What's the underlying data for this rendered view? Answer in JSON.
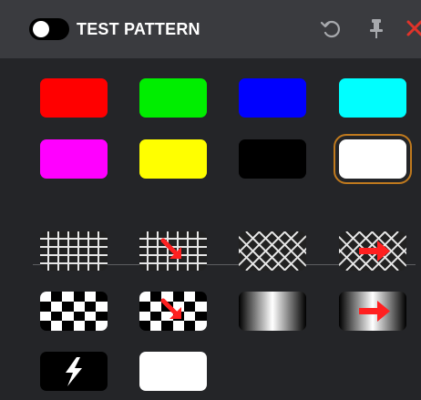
{
  "header": {
    "title": "TEST PATTERN",
    "toggle_state": "off",
    "icons": [
      "reset-icon",
      "pin-icon",
      "close-icon"
    ],
    "colors": {
      "header_bg": "#3a3b3f",
      "panel_bg": "#242528",
      "close": "#e0332a",
      "selection_ring": "#c07a1e"
    }
  },
  "color_swatches": [
    {
      "name": "red",
      "color": "#ff0000"
    },
    {
      "name": "green",
      "color": "#00ee00"
    },
    {
      "name": "blue",
      "color": "#0000ff"
    },
    {
      "name": "cyan",
      "color": "#00ffff"
    },
    {
      "name": "magenta",
      "color": "#ff00ff"
    },
    {
      "name": "yellow",
      "color": "#ffff00"
    },
    {
      "name": "black",
      "color": "#000000"
    },
    {
      "name": "white",
      "color": "#ffffff",
      "selected": true
    }
  ],
  "patterns": [
    "grid-pattern",
    "grid-pattern-animated",
    "diagonal-grid-pattern",
    "diagonal-grid-pattern-animated",
    "checkerboard-pattern",
    "checkerboard-pattern-animated",
    "gradient-pattern",
    "gradient-pattern-animated",
    "flash-pattern",
    "blank-white-pattern"
  ]
}
